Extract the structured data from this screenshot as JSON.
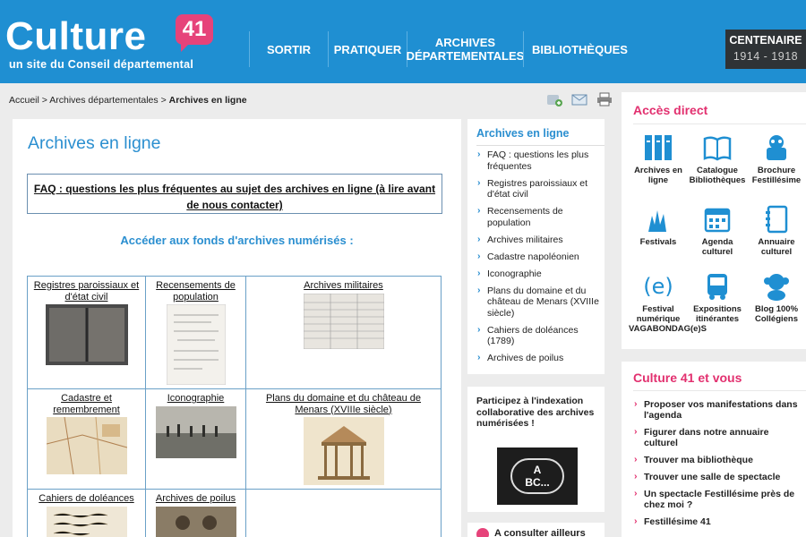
{
  "header": {
    "logo_word": "Culture",
    "logo_number": "41",
    "logo_tagline": "un site du Conseil départemental",
    "nav": [
      {
        "label": "SORTIR"
      },
      {
        "label": "PRATIQUER"
      },
      {
        "label": "ARCHIVES DÉPARTEMENTALES"
      },
      {
        "label": "BIBLIOTHÈQUES"
      }
    ],
    "centenaire_title": "CENTENAIRE",
    "centenaire_years": "1914 - 1918"
  },
  "breadcrumb": {
    "home": "Accueil",
    "sep1": " > ",
    "section": "Archives départementales",
    "sep2": " > ",
    "current": "Archives en ligne"
  },
  "toolbar": {
    "icons": [
      "share-icon",
      "mail-icon",
      "print-icon"
    ]
  },
  "main": {
    "title": "Archives en ligne",
    "faq_link": "FAQ : questions les plus fréquentes au sujet des archives en ligne (à lire avant de nous contacter)",
    "fonds_title": "Accéder aux fonds d'archives numérisés :",
    "cells": [
      {
        "label": "Registres paroissiaux et d'état civil"
      },
      {
        "label": "Recensements de population"
      },
      {
        "label": "Archives militaires"
      },
      {
        "label": "Cadastre et remembrement"
      },
      {
        "label": "Iconographie"
      },
      {
        "label": "Plans du domaine et du château de Menars (XVIIIe siècle)"
      },
      {
        "label": "Cahiers de doléances"
      },
      {
        "label": "Archives de poilus"
      }
    ]
  },
  "middle": {
    "title": "Archives en ligne",
    "items": [
      "FAQ : questions les plus fréquentes",
      "Registres paroissiaux et d'état civil",
      "Recensements de population",
      "Archives militaires",
      "Cadastre napoléonien",
      "Iconographie",
      "Plans du domaine et du château de Menars (XVIIIe siècle)",
      "Cahiers de doléances (1789)",
      "Archives de poilus"
    ],
    "indexation_text": "Participez à l'indexation collaborative des archives numérisées !",
    "indexation_logo_line1": "A",
    "indexation_logo_line2": "BC...",
    "consult_text": "A consulter ailleurs"
  },
  "right": {
    "access_title": "Accès direct",
    "access_items": [
      {
        "label": "Archives en ligne",
        "icon": "archives-icon"
      },
      {
        "label": "Catalogue Bibliothèques",
        "icon": "book-icon"
      },
      {
        "label": "Brochure Festillésime",
        "icon": "brochure-icon"
      },
      {
        "label": "Festivals",
        "icon": "festival-hands-icon"
      },
      {
        "label": "Agenda culturel",
        "icon": "calendar-icon"
      },
      {
        "label": "Annuaire culturel",
        "icon": "directory-icon"
      },
      {
        "label": "Festival numérique VAGABONDAG(e)S",
        "icon": "vagabondages-icon"
      },
      {
        "label": "Expositions itinérantes",
        "icon": "bus-icon"
      },
      {
        "label": "Blog 100% Collégiens",
        "icon": "monkey-icon"
      }
    ],
    "culture_title": "Culture 41 et vous",
    "culture_items": [
      "Proposer vos manifestations dans l'agenda",
      "Figurer dans notre annuaire culturel",
      "Trouver ma bibliothèque",
      "Trouver une salle de spectacle",
      "Un spectacle Festillésime près de chez moi ?",
      "Festillésime 41"
    ]
  },
  "colors": {
    "header_blue": "#1f8fd2",
    "title_blue": "#2b8fd0",
    "accent_pink": "#e2306f",
    "background": "#ececec"
  }
}
